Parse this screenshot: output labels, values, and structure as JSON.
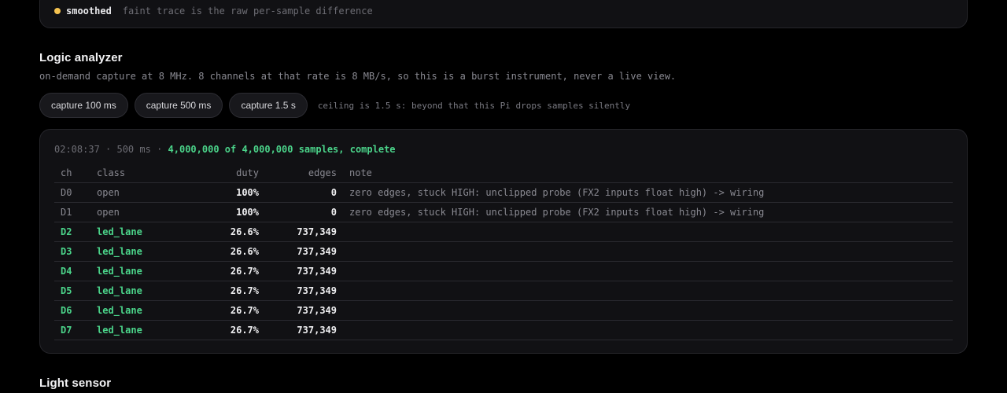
{
  "top_card": {
    "legend_label": "smoothed",
    "legend_note": "faint trace is the raw per-sample difference",
    "legend_color": "#f5c350"
  },
  "logic_analyzer": {
    "title": "Logic analyzer",
    "description": "on-demand capture at 8 MHz. 8 channels at that rate is 8 MB/s, so this is a burst instrument, never a live view.",
    "buttons": [
      "capture 100 ms",
      "capture 500 ms",
      "capture 1.5 s"
    ],
    "ceiling_note": "ceiling is 1.5 s: beyond that this Pi drops samples silently",
    "capture": {
      "time": "02:08:37",
      "duration": "500 ms",
      "samples_status": "4,000,000 of 4,000,000 samples, complete",
      "status_color": "#4bd48a"
    },
    "table": {
      "headers": [
        "ch",
        "class",
        "duty",
        "edges",
        "note"
      ],
      "rows": [
        {
          "ch": "D0",
          "class": "open",
          "duty": "100%",
          "edges": "0",
          "note": "zero edges, stuck HIGH: unclipped probe (FX2 inputs float high) -> wiring"
        },
        {
          "ch": "D1",
          "class": "open",
          "duty": "100%",
          "edges": "0",
          "note": "zero edges, stuck HIGH: unclipped probe (FX2 inputs float high) -> wiring"
        },
        {
          "ch": "D2",
          "class": "led_lane",
          "duty": "26.6%",
          "edges": "737,349",
          "note": ""
        },
        {
          "ch": "D3",
          "class": "led_lane",
          "duty": "26.6%",
          "edges": "737,349",
          "note": ""
        },
        {
          "ch": "D4",
          "class": "led_lane",
          "duty": "26.7%",
          "edges": "737,349",
          "note": ""
        },
        {
          "ch": "D5",
          "class": "led_lane",
          "duty": "26.7%",
          "edges": "737,349",
          "note": ""
        },
        {
          "ch": "D6",
          "class": "led_lane",
          "duty": "26.7%",
          "edges": "737,349",
          "note": ""
        },
        {
          "ch": "D7",
          "class": "led_lane",
          "duty": "26.7%",
          "edges": "737,349",
          "note": ""
        }
      ]
    }
  },
  "light_sensor": {
    "title": "Light sensor"
  }
}
